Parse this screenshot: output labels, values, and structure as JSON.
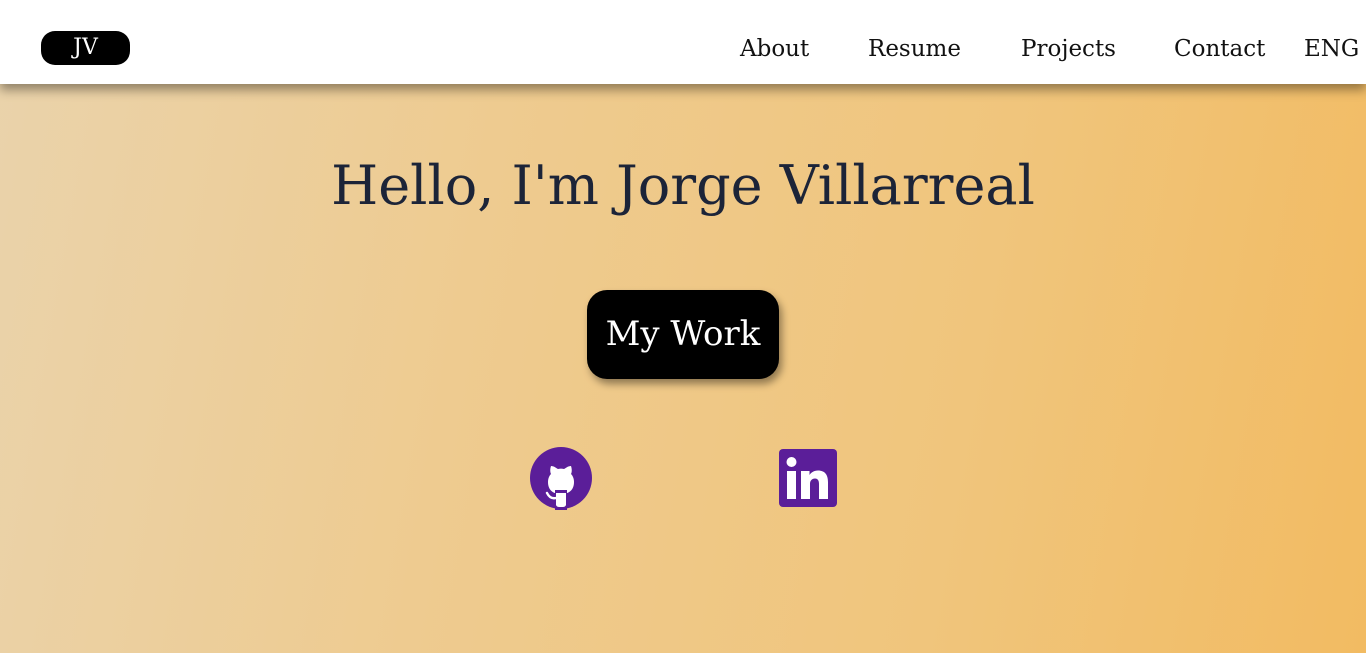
{
  "header": {
    "logo": "JV",
    "nav": [
      {
        "label": "About"
      },
      {
        "label": "Resume"
      },
      {
        "label": "Projects"
      },
      {
        "label": "Contact"
      }
    ],
    "language": "ENG"
  },
  "hero": {
    "title": "Hello, I'm Jorge Villarreal",
    "cta_label": "My Work"
  },
  "social": [
    {
      "name": "github-icon",
      "color": "#5b1e99"
    },
    {
      "name": "linkedin-icon",
      "color": "#5b1e99"
    }
  ],
  "colors": {
    "background_gradient": [
      "#ead3ab",
      "#f2bb62"
    ],
    "icon_accent": "#5b1e99",
    "title_text": "#1c2438"
  }
}
